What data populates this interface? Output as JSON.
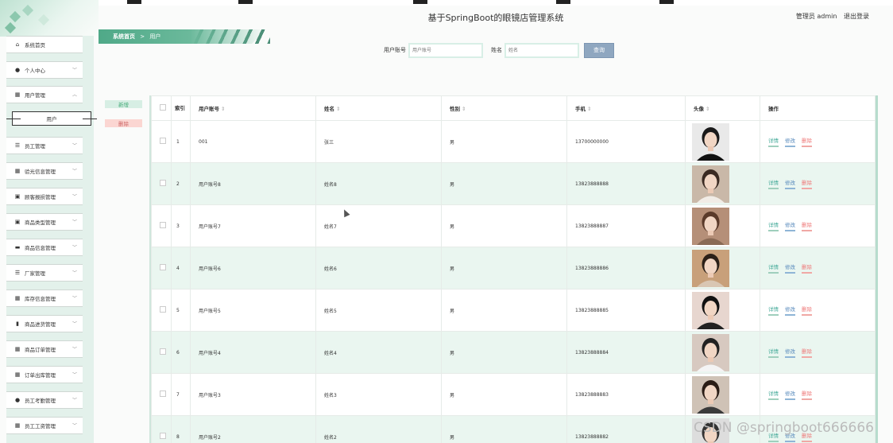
{
  "header": {
    "title": "基于SpringBoot的眼镜店管理系统",
    "admin_text": "管理员 admin",
    "logout": "退出登录"
  },
  "breadcrumb": {
    "home": "系统首页",
    "sep": ">",
    "current": "用户"
  },
  "search": {
    "label1": "用户账号",
    "placeholder1": "用户账号",
    "label2": "姓名",
    "placeholder2": "姓名",
    "button": "查询"
  },
  "actions": {
    "add": "新增",
    "delete": "删除"
  },
  "sidebar": {
    "items": [
      {
        "label": "系统首页",
        "icon": "home-icon",
        "glyph": "⌂",
        "chevron": false
      },
      {
        "label": "个人中心",
        "icon": "user-icon",
        "glyph": "●",
        "chevron": true
      },
      {
        "label": "用户管理",
        "icon": "grid-icon",
        "glyph": "▦",
        "chevron": true,
        "expanded": true
      },
      {
        "label": "员工管理",
        "icon": "list-icon",
        "glyph": "☰",
        "chevron": true
      },
      {
        "label": "验光信息管理",
        "icon": "grid-icon",
        "glyph": "▦",
        "chevron": true
      },
      {
        "label": "顾客报损管理",
        "icon": "clipboard-icon",
        "glyph": "▣",
        "chevron": true
      },
      {
        "label": "商品类型管理",
        "icon": "clipboard-icon",
        "glyph": "▣",
        "chevron": true
      },
      {
        "label": "商品信息管理",
        "icon": "monitor-icon",
        "glyph": "▬",
        "chevron": true
      },
      {
        "label": "厂家管理",
        "icon": "list-icon",
        "glyph": "☰",
        "chevron": true
      },
      {
        "label": "库存信息管理",
        "icon": "grid-icon",
        "glyph": "▦",
        "chevron": true
      },
      {
        "label": "商品进货管理",
        "icon": "chart-icon",
        "glyph": "▮",
        "chevron": true
      },
      {
        "label": "商品订单管理",
        "icon": "grid-icon",
        "glyph": "▦",
        "chevron": true
      },
      {
        "label": "订单出库管理",
        "icon": "grid-icon",
        "glyph": "▦",
        "chevron": true
      },
      {
        "label": "员工考勤管理",
        "icon": "user-icon",
        "glyph": "●",
        "chevron": true
      },
      {
        "label": "员工工资管理",
        "icon": "grid-icon",
        "glyph": "▦",
        "chevron": true
      }
    ],
    "submenu": {
      "label": "用户"
    }
  },
  "table": {
    "headers": [
      "索引",
      "用户账号",
      "姓名",
      "性别",
      "手机",
      "头像",
      "操作"
    ],
    "ops": {
      "detail": "详情",
      "edit": "修改",
      "delete": "删除"
    },
    "rows": [
      {
        "idx": "1",
        "account": "001",
        "name": "张三",
        "gender": "男",
        "phone": "13700000000"
      },
      {
        "idx": "2",
        "account": "用户账号8",
        "name": "姓名8",
        "gender": "男",
        "phone": "13823888888"
      },
      {
        "idx": "3",
        "account": "用户账号7",
        "name": "姓名7",
        "gender": "男",
        "phone": "13823888887"
      },
      {
        "idx": "4",
        "account": "用户账号6",
        "name": "姓名6",
        "gender": "男",
        "phone": "13823888886"
      },
      {
        "idx": "5",
        "account": "用户账号5",
        "name": "姓名5",
        "gender": "男",
        "phone": "13823888885"
      },
      {
        "idx": "6",
        "account": "用户账号4",
        "name": "姓名4",
        "gender": "男",
        "phone": "13823888884"
      },
      {
        "idx": "7",
        "account": "用户账号3",
        "name": "姓名3",
        "gender": "男",
        "phone": "13823888883"
      },
      {
        "idx": "8",
        "account": "用户账号2",
        "name": "姓名2",
        "gender": "男",
        "phone": "13823888882"
      }
    ]
  },
  "watermark": "CSDN @springboot666666",
  "colors": {
    "accent": "#4fa988",
    "sidebar_bg": "#e3f1eb",
    "row_alt": "#eaf6f0",
    "detail": "#44aa99",
    "edit": "#5588bb",
    "delete": "#ee7777"
  }
}
